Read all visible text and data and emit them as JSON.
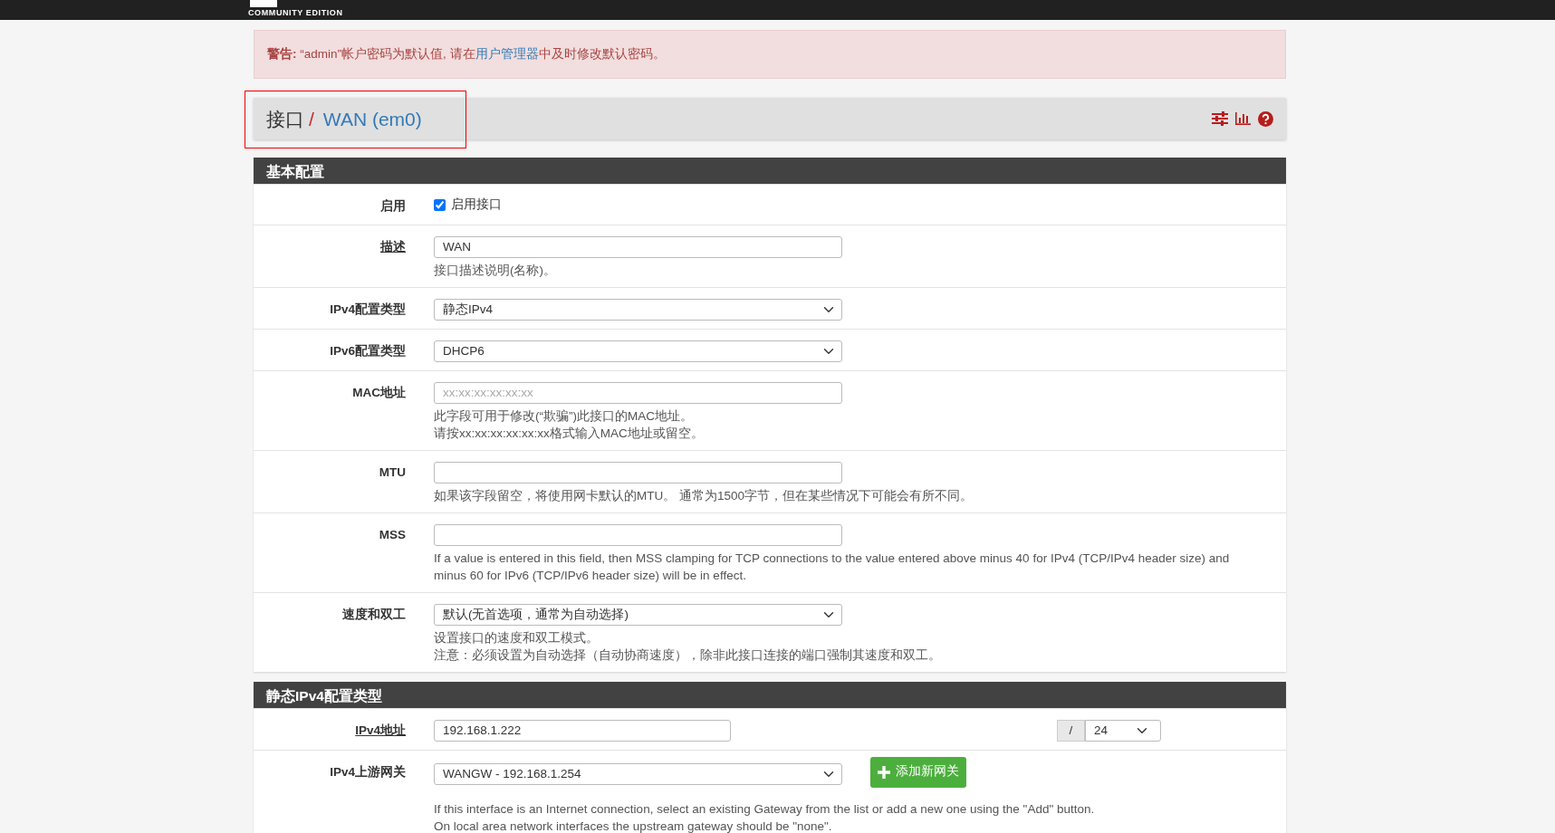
{
  "navbar": {
    "logo_subtitle": "COMMUNITY EDITION"
  },
  "alert": {
    "label": "警告:",
    "before": " “admin”帐户密码为默认值, 请在",
    "link": "用户管理器",
    "after": "中及时修改默认密码。"
  },
  "breadcrumb": {
    "highlighted": true,
    "separator": "/",
    "items": [
      {
        "text": "接口",
        "link": false
      },
      {
        "text": "WAN (em0)",
        "link": true
      }
    ]
  },
  "sections": [
    {
      "title": "基本配置",
      "rows": [
        {
          "label": "启用",
          "required": false,
          "kind": "checkbox",
          "checked": true,
          "text": "启用接口"
        },
        {
          "label": "描述",
          "required": true,
          "kind": "text",
          "value": "WAN",
          "help": [
            "接口描述说明(名称)。"
          ]
        },
        {
          "label": "IPv4配置类型",
          "required": false,
          "kind": "select",
          "value": "静态IPv4"
        },
        {
          "label": "IPv6配置类型",
          "required": false,
          "kind": "select",
          "value": "DHCP6"
        },
        {
          "label": "MAC地址",
          "required": false,
          "kind": "text",
          "placeholder": "xx:xx:xx:xx:xx:xx",
          "help": [
            "此字段可用于修改(“欺骗”)此接口的MAC地址。",
            "请按xx:xx:xx:xx:xx:xx格式输入MAC地址或留空。"
          ]
        },
        {
          "label": "MTU",
          "required": false,
          "kind": "text",
          "help": [
            "如果该字段留空，将使用网卡默认的MTU。 通常为1500字节，但在某些情况下可能会有所不同。"
          ]
        },
        {
          "label": "MSS",
          "required": false,
          "kind": "text",
          "help": [
            "If a value is entered in this field, then MSS clamping for TCP connections to the value entered above minus 40 for IPv4 (TCP/IPv4 header size) and minus 60 for IPv6 (TCP/IPv6 header size) will be in effect."
          ]
        },
        {
          "label": "速度和双工",
          "required": false,
          "kind": "select",
          "value": "默认(无首选项，通常为自动选择)",
          "help": [
            "设置接口的速度和双工模式。",
            "注意：必须设置为自动选择（自动协商速度），除非此接口连接的端口强制其速度和双工。"
          ]
        }
      ]
    },
    {
      "title": "静态IPv4配置类型",
      "rows": [
        {
          "label": "IPv4地址",
          "required": true,
          "kind": "address",
          "value": "192.168.1.222",
          "separator": "/",
          "cidr": "24"
        },
        {
          "label": "IPv4上游网关",
          "required": false,
          "kind": "select_button",
          "value": "WANGW - 192.168.1.254",
          "button": "添加新网关",
          "help": [
            "If this interface is an Internet connection, select an existing Gateway from the list or add a new one using the \"Add\" button.",
            "On local area network interfaces the upstream gateway should be \"none\"."
          ]
        }
      ]
    }
  ]
}
